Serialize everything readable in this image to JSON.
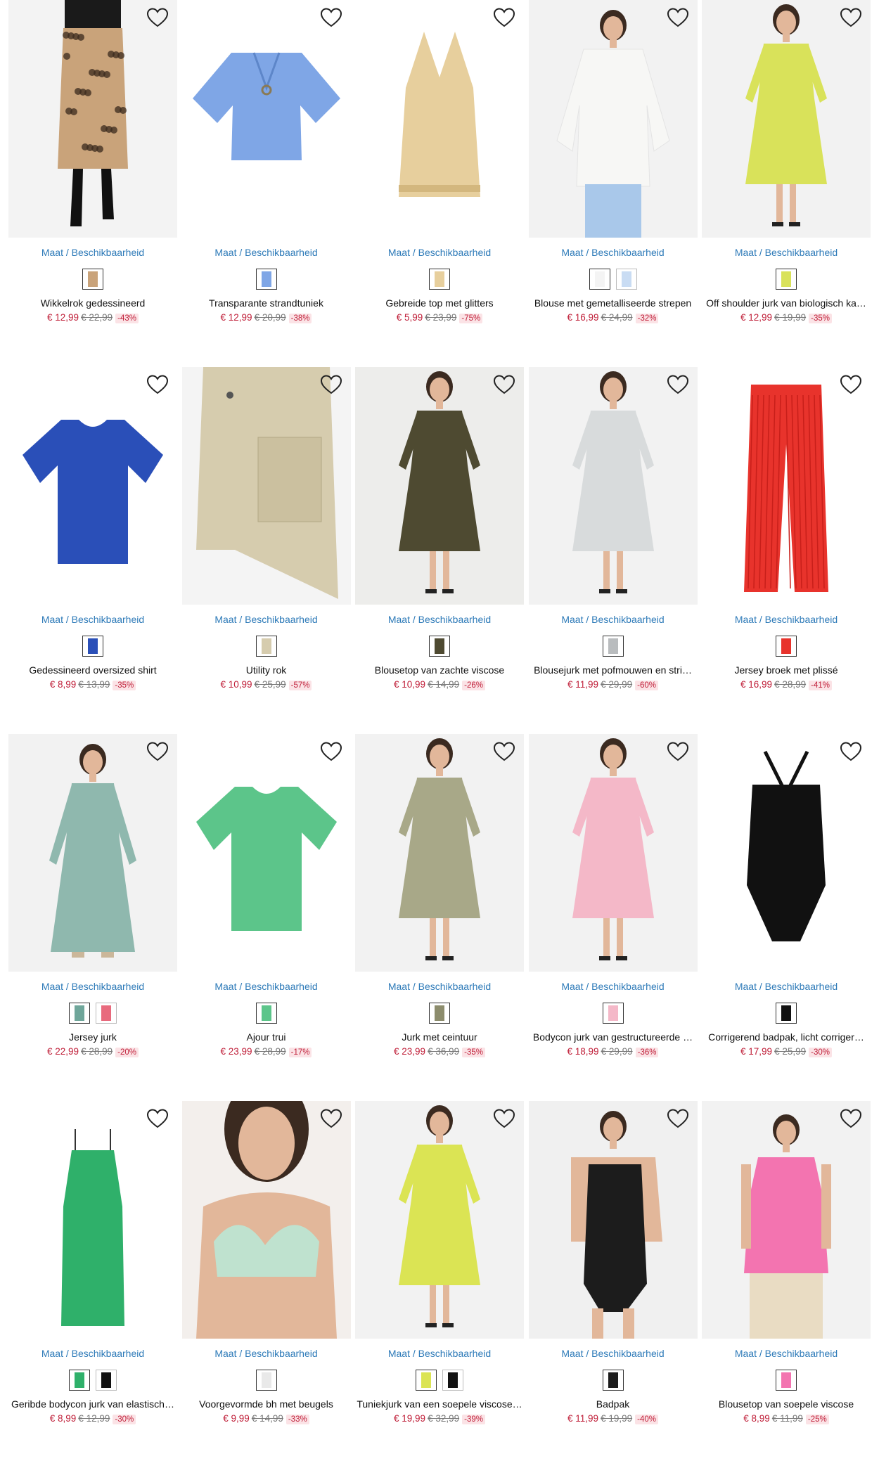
{
  "common": {
    "avail_link": "Maat / Beschikbaarheid",
    "wishlist_icon": "heart-outline-icon"
  },
  "products": [
    {
      "name": "Wikkelrok gedessineerd",
      "price": "€ 12,99",
      "old_price": "€ 22,99",
      "discount": "-43%",
      "img_bg": "#f3f3f3",
      "garment": "#c9a37a",
      "shape": "skirt-model",
      "swatches": [
        "#c9a37a"
      ]
    },
    {
      "name": "Transparante strandtuniek",
      "price": "€ 12,99",
      "old_price": "€ 20,99",
      "discount": "-38%",
      "img_bg": "#ffffff",
      "garment": "#7fa6e6",
      "shape": "tunic",
      "swatches": [
        "#7fa6e6"
      ]
    },
    {
      "name": "Gebreide top met glitters",
      "price": "€ 5,99",
      "old_price": "€ 23,99",
      "discount": "-75%",
      "img_bg": "#ffffff",
      "garment": "#e7cf9d",
      "shape": "halter",
      "swatches": [
        "#e7cf9d"
      ]
    },
    {
      "name": "Blouse met gemetalliseerde strepen",
      "price": "€ 16,99",
      "old_price": "€ 24,99",
      "discount": "-32%",
      "img_bg": "#f2f2f2",
      "garment": "#f7f7f5",
      "shape": "blouse-model",
      "swatches": [
        "#f4f4f4",
        "#c9dcf3"
      ]
    },
    {
      "name": "Off shoulder jurk van biologisch ka…",
      "price": "€ 12,99",
      "old_price": "€ 19,99",
      "discount": "-35%",
      "img_bg": "#f2f2f2",
      "garment": "#d9e25a",
      "shape": "dress-model",
      "swatches": [
        "#d9e25a"
      ]
    },
    {
      "name": "Gedessineerd oversized shirt",
      "price": "€ 8,99",
      "old_price": "€ 13,99",
      "discount": "-35%",
      "img_bg": "#ffffff",
      "garment": "#2a4fb8",
      "shape": "tee",
      "swatches": [
        "#2a4fb8"
      ]
    },
    {
      "name": "Utility rok",
      "price": "€ 10,99",
      "old_price": "€ 25,99",
      "discount": "-57%",
      "img_bg": "#f4f4f4",
      "garment": "#d6ccae",
      "shape": "cargo-skirt",
      "swatches": [
        "#d6ccae"
      ]
    },
    {
      "name": "Blousetop van zachte viscose",
      "price": "€ 10,99",
      "old_price": "€ 14,99",
      "discount": "-26%",
      "img_bg": "#ededeb",
      "garment": "#4e4a31",
      "shape": "dress-model",
      "swatches": [
        "#4e4a31"
      ]
    },
    {
      "name": "Blousejurk met pofmouwen en stri…",
      "price": "€ 11,99",
      "old_price": "€ 29,99",
      "discount": "-60%",
      "img_bg": "#f2f2f2",
      "garment": "#d8dbdc",
      "shape": "dress-model",
      "swatches": [
        "#b9bcbe"
      ]
    },
    {
      "name": "Jersey broek met plissé",
      "price": "€ 16,99",
      "old_price": "€ 28,99",
      "discount": "-41%",
      "img_bg": "#ffffff",
      "garment": "#e8332c",
      "shape": "pants",
      "swatches": [
        "#e8332c"
      ]
    },
    {
      "name": "Jersey jurk",
      "price": "€ 22,99",
      "old_price": "€ 28,99",
      "discount": "-20%",
      "img_bg": "#f2f2f2",
      "garment": "#8fb8ae",
      "shape": "maxi-model",
      "swatches": [
        "#6fa69a",
        "#e86a7d"
      ]
    },
    {
      "name": "Ajour trui",
      "price": "€ 23,99",
      "old_price": "€ 28,99",
      "discount": "-17%",
      "img_bg": "#ffffff",
      "garment": "#5cc58a",
      "shape": "tee",
      "swatches": [
        "#5cc58a"
      ]
    },
    {
      "name": "Jurk met ceintuur",
      "price": "€ 23,99",
      "old_price": "€ 36,99",
      "discount": "-35%",
      "img_bg": "#f2f2f2",
      "garment": "#a8a888",
      "shape": "dress-model",
      "swatches": [
        "#8c8c6c"
      ]
    },
    {
      "name": "Bodycon jurk van gestructureerde …",
      "price": "€ 18,99",
      "old_price": "€ 29,99",
      "discount": "-36%",
      "img_bg": "#f2f2f2",
      "garment": "#f4b8c8",
      "shape": "dress-model",
      "swatches": [
        "#f4b8c8"
      ]
    },
    {
      "name": "Corrigerend badpak, licht corriger…",
      "price": "€ 17,99",
      "old_price": "€ 25,99",
      "discount": "-30%",
      "img_bg": "#ffffff",
      "garment": "#111111",
      "shape": "swimsuit",
      "swatches": [
        "#111111"
      ]
    },
    {
      "name": "Geribde bodycon jurk van elastisch…",
      "price": "€ 8,99",
      "old_price": "€ 12,99",
      "discount": "-30%",
      "img_bg": "#ffffff",
      "garment": "#2fb06a",
      "shape": "slip-dress",
      "swatches": [
        "#2fb06a",
        "#111111"
      ]
    },
    {
      "name": "Voorgevormde bh met beugels",
      "price": "€ 9,99",
      "old_price": "€ 14,99",
      "discount": "-33%",
      "img_bg": "#f3efec",
      "garment": "#bfe2cf",
      "shape": "bra-model",
      "swatches": [
        "#e9e9e9"
      ]
    },
    {
      "name": "Tuniekjurk van een soepele viscose…",
      "price": "€ 19,99",
      "old_price": "€ 32,99",
      "discount": "-39%",
      "img_bg": "#f2f2f2",
      "garment": "#dbe454",
      "shape": "dress-model",
      "swatches": [
        "#dbe454",
        "#111111"
      ]
    },
    {
      "name": "Badpak",
      "price": "€ 11,99",
      "old_price": "€ 19,99",
      "discount": "-40%",
      "img_bg": "#f0f0f0",
      "garment": "#1c1c1c",
      "shape": "swim-model",
      "swatches": [
        "#1c1c1c"
      ]
    },
    {
      "name": "Blousetop van soepele viscose",
      "price": "€ 8,99",
      "old_price": "€ 11,99",
      "discount": "-25%",
      "img_bg": "#f2f2f2",
      "garment": "#f374b0",
      "shape": "top-model",
      "swatches": [
        "#f374b0"
      ]
    }
  ]
}
